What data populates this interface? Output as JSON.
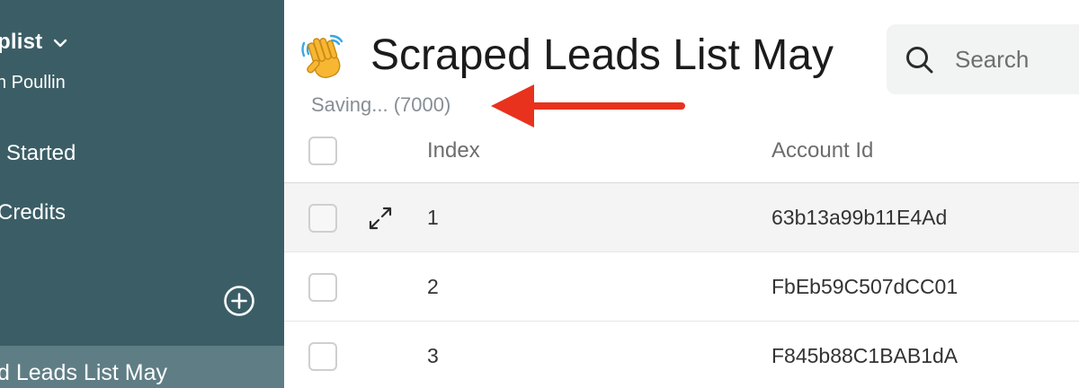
{
  "sidebar": {
    "workspace_name": "plist",
    "user_name": "n Poullin",
    "items": [
      {
        "label": "Started"
      },
      {
        "label": "Credits"
      }
    ],
    "selected_list": "d Leads List May"
  },
  "header": {
    "emoji": "👋",
    "title": "Scraped Leads List May",
    "status": "Saving... (7000)"
  },
  "search": {
    "placeholder": "Search"
  },
  "table": {
    "columns": [
      "Index",
      "Account Id"
    ],
    "rows": [
      {
        "index": "1",
        "account_id": "63b13a99b11E4Ad"
      },
      {
        "index": "2",
        "account_id": "FbEb59C507dCC01"
      },
      {
        "index": "3",
        "account_id": "F845b88C1BAB1dA"
      }
    ]
  },
  "colors": {
    "sidebar_bg": "#3b5e66",
    "sidebar_selected": "#5f7d85",
    "annotation_arrow": "#e8321d",
    "status_text": "#868e96"
  }
}
